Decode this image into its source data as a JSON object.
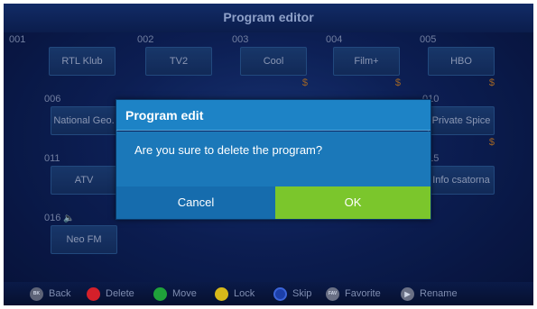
{
  "screen": {
    "title": "Program editor"
  },
  "slots": [
    {
      "number": "001",
      "name": "RTL Klub",
      "dollar": ""
    },
    {
      "number": "002",
      "name": "TV2",
      "dollar": ""
    },
    {
      "number": "003",
      "name": "Cool",
      "dollar": "$"
    },
    {
      "number": "004",
      "name": "Film+",
      "dollar": "$"
    },
    {
      "number": "005",
      "name": "HBO",
      "dollar": "$"
    },
    {
      "number": "006",
      "name": "National Geo.",
      "dollar": "$"
    },
    {
      "number": "010",
      "name": "Private Spice",
      "dollar": "$"
    },
    {
      "number": "011",
      "name": "ATV",
      "dollar": "$"
    },
    {
      "number": "015",
      "name": "Info csatorna",
      "dollar": ""
    },
    {
      "number": "016",
      "name": "Neo FM",
      "dollar": "",
      "icon": "speaker-icon"
    }
  ],
  "dialog": {
    "title": "Program edit",
    "message": "Are you sure to delete the program?",
    "cancel_label": "Cancel",
    "ok_label": "OK"
  },
  "footer": {
    "items": [
      {
        "label": "Back",
        "icon": "back-key-icon",
        "color": "#5d6377"
      },
      {
        "label": "Delete",
        "icon": "red-key-icon",
        "color": "#d4202a"
      },
      {
        "label": "Move",
        "icon": "green-key-icon",
        "color": "#1fa23a"
      },
      {
        "label": "Lock",
        "icon": "yellow-key-icon",
        "color": "#d7b81a"
      },
      {
        "label": "Skip",
        "icon": "blue-key-icon",
        "color": "#1c3fa8"
      },
      {
        "label": "Favorite",
        "icon": "fav-key-icon",
        "color": "#6a7085"
      },
      {
        "label": "Rename",
        "icon": "play-key-icon",
        "color": "#6a7085"
      }
    ]
  },
  "colors": {
    "dialog_header": "#1d83c6",
    "ok_button": "#7bc62c",
    "cancel_button": "#166cad",
    "price_tag": "#c07b2a"
  }
}
